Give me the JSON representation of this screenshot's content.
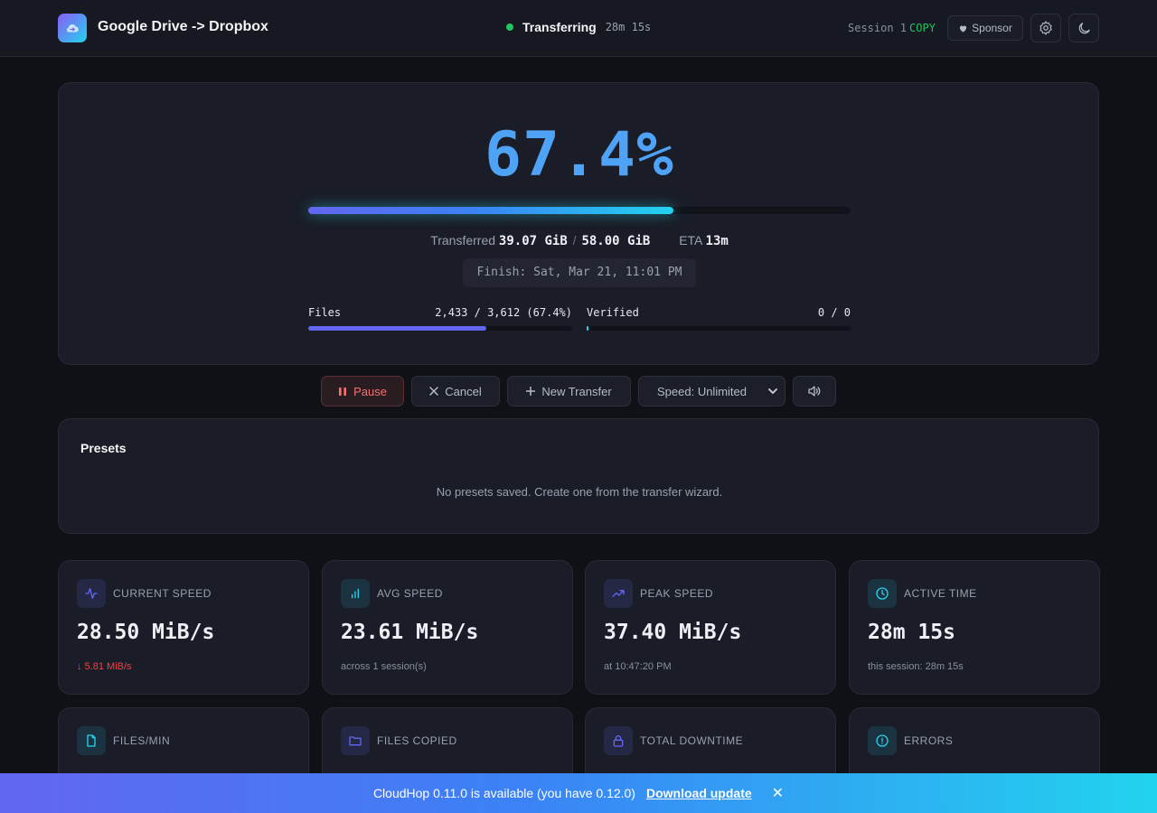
{
  "header": {
    "app_title": "Google Drive -> Dropbox",
    "status_text": "Transferring",
    "elapsed": "28m 15s",
    "session_label": "Session 1",
    "copy_label": "COPY",
    "sponsor_label": "Sponsor",
    "status_color": "#22c55e"
  },
  "progress": {
    "percent_text": "67.4%",
    "percent_fraction": 0.674,
    "transferred_label": "Transferred",
    "transferred": "39.07 GiB",
    "total": "58.00 GiB",
    "eta_label": "ETA",
    "eta": "13m",
    "finish": "Finish: Sat, Mar 21, 11:01 PM",
    "files_label": "Files",
    "files_value": "2,433 / 3,612 (67.4%)",
    "files_fraction": 0.674,
    "verified_label": "Verified",
    "verified_value": "0 / 0",
    "verified_fraction": 0.0
  },
  "actions": {
    "pause_label": "Pause",
    "cancel_label": "Cancel",
    "new_transfer_label": "New Transfer",
    "speed_label": "Speed: Unlimited"
  },
  "presets": {
    "title": "Presets",
    "empty_text": "No presets saved. Create one from the transfer wizard."
  },
  "stats": [
    {
      "label": "CURRENT SPEED",
      "value": "28.50 MiB/s",
      "sub": "5.81 MiB/s",
      "icon": "activity-icon",
      "accent": "#6366f1"
    },
    {
      "label": "AVG SPEED",
      "value": "23.61 MiB/s",
      "sub": "across 1 session(s)",
      "icon": "bar-chart-icon",
      "accent": "#22d3ee"
    },
    {
      "label": "PEAK SPEED",
      "value": "37.40 MiB/s",
      "sub": "at 10:47:20 PM",
      "icon": "trending-up-icon",
      "accent": "#6366f1"
    },
    {
      "label": "ACTIVE TIME",
      "value": "28m 15s",
      "sub": "this session: 28m 15s",
      "icon": "clock-icon",
      "accent": "#22d3ee"
    },
    {
      "label": "FILES/MIN",
      "icon": "file-icon",
      "accent": "#22d3ee"
    },
    {
      "label": "FILES COPIED",
      "icon": "folder-icon",
      "accent": "#6366f1"
    },
    {
      "label": "TOTAL DOWNTIME",
      "icon": "lock-icon",
      "accent": "#6366f1"
    },
    {
      "label": "ERRORS",
      "icon": "alert-circle-icon",
      "accent": "#22d3ee"
    }
  ],
  "banner": {
    "message": "CloudHop 0.11.0 is available (you have 0.12.0)",
    "link_label": "Download update"
  }
}
